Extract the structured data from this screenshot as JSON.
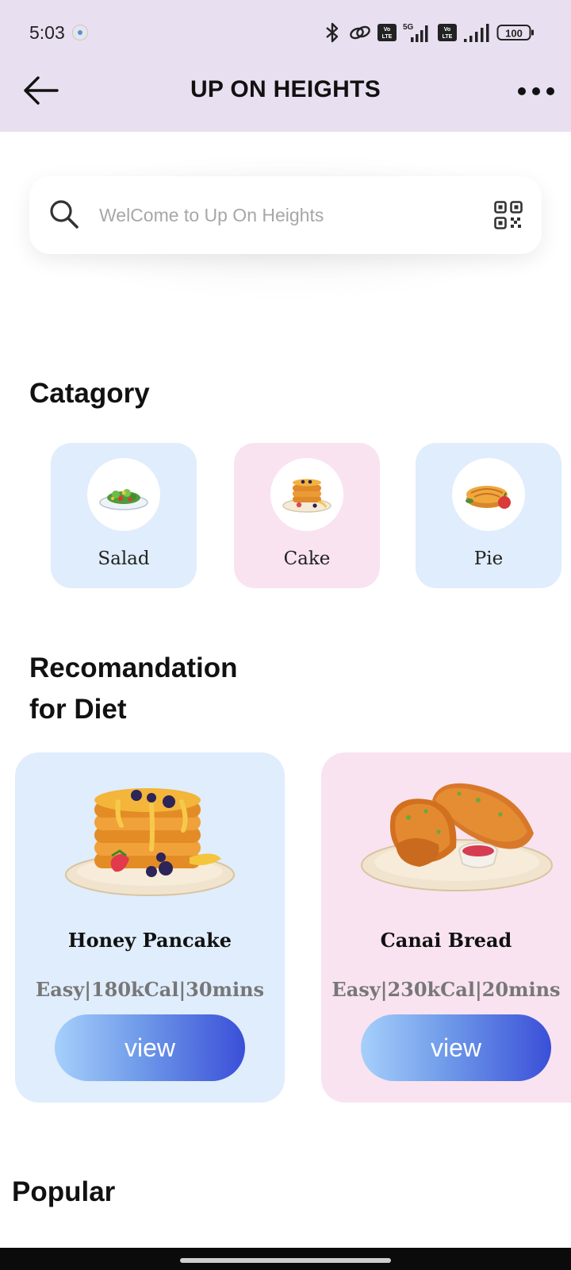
{
  "status": {
    "time": "5:03",
    "icons": [
      "bluetooth-icon",
      "link-icon",
      "volte-icon",
      "5g-signal-icon",
      "volte-icon",
      "signal-icon",
      "battery-icon"
    ],
    "network": "5G",
    "volte": "Vo LTE",
    "battery": "100"
  },
  "header": {
    "title": "UP ON HEIGHTS",
    "back_icon": "arrow-left-icon",
    "menu_icon": "more-dots-icon",
    "background": "#e8dff0"
  },
  "search": {
    "placeholder": "WelCome to Up On Heights",
    "icon": "search-icon",
    "scan_icon": "qr-code-icon"
  },
  "category": {
    "title": "Catagory",
    "items": [
      {
        "label": "Salad",
        "icon": "salad-icon",
        "color": "#dfedfc"
      },
      {
        "label": "Cake",
        "icon": "pancake-icon",
        "color": "#f9e3f0"
      },
      {
        "label": "Pie",
        "icon": "pie-icon",
        "color": "#dfedfc"
      }
    ]
  },
  "recommendation": {
    "title_line1": "Recomandation",
    "title_line2": "for Diet",
    "items": [
      {
        "name": "Honey Pancake",
        "meta": "Easy|180kCal|30mins",
        "button": "view",
        "image": "honey-pancake-image",
        "color": "#dfedfc"
      },
      {
        "name": "Canai Bread",
        "meta": "Easy|230kCal|20mins",
        "button": "view",
        "image": "canai-bread-image",
        "color": "#f9e3f0"
      }
    ]
  },
  "popular": {
    "title": "Popular"
  }
}
